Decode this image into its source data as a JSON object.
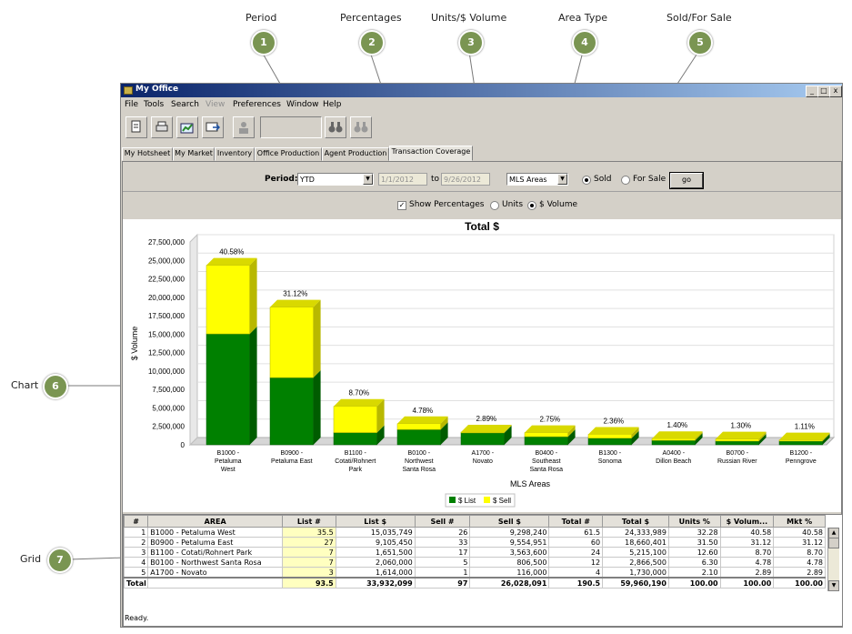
{
  "callouts": [
    {
      "num": "1",
      "label": "Period"
    },
    {
      "num": "2",
      "label": "Percentages"
    },
    {
      "num": "3",
      "label": "Units/$ Volume"
    },
    {
      "num": "4",
      "label": "Area Type"
    },
    {
      "num": "5",
      "label": "Sold/For Sale"
    },
    {
      "num": "6",
      "label": "Chart"
    },
    {
      "num": "7",
      "label": "Grid"
    }
  ],
  "window": {
    "title": "My Office",
    "controls": [
      "_",
      "□",
      "x"
    ]
  },
  "menu": [
    "File",
    "Tools",
    "Search",
    "View",
    "Preferences",
    "Window",
    "Help"
  ],
  "tabs": [
    "My Hotsheet",
    "My Market",
    "Inventory",
    "Office Production",
    "Agent Production",
    "Transaction Coverage"
  ],
  "active_tab": "Transaction Coverage",
  "filters": {
    "period_label": "Period:",
    "period_value": "YTD",
    "date_from": "1/1/2012",
    "to_label": "to",
    "date_to": "9/26/2012",
    "area_type": "MLS Areas",
    "sold_label": "Sold",
    "for_sale_label": "For Sale",
    "go_label": "go",
    "show_percentages": "Show Percentages",
    "units_label": "Units",
    "volume_label": "$ Volume"
  },
  "colors": {
    "list": "#008000",
    "sell": "#ffff00",
    "accent": "#7a9552"
  },
  "chart_data": {
    "type": "bar",
    "stacked": true,
    "title": "Total $",
    "xlabel": "MLS Areas",
    "ylabel": "$ Volume",
    "ylim": [
      0,
      27500000
    ],
    "yticks": [
      "27,500,000",
      "25,000,000",
      "22,500,000",
      "20,000,000",
      "17,500,000",
      "15,000,000",
      "12,500,000",
      "10,000,000",
      "7,500,000",
      "5,000,000",
      "2,500,000",
      "0"
    ],
    "categories": [
      [
        "B1000 -",
        "Petaluma",
        "West"
      ],
      [
        "B0900 -",
        "Petaluma East"
      ],
      [
        "B1100 -",
        "Cotati/Rohnert",
        "Park"
      ],
      [
        "B0100 -",
        "Northwest",
        "Santa Rosa"
      ],
      [
        "A1700 -",
        "Novato"
      ],
      [
        "B0400 -",
        "Southeast",
        "Santa Rosa"
      ],
      [
        "B1300 -",
        "Sonoma"
      ],
      [
        "A0400 -",
        "Dillon Beach"
      ],
      [
        "B0700 -",
        "Russian River"
      ],
      [
        "B1200 -",
        "Penngrove"
      ]
    ],
    "series": [
      {
        "name": "$ List",
        "values": [
          15035749,
          9105450,
          1651500,
          2060000,
          1614000,
          1100000,
          900000,
          600000,
          500000,
          500000
        ]
      },
      {
        "name": "$ Sell",
        "values": [
          9298240,
          9554951,
          3563600,
          806500,
          116000,
          550000,
          520000,
          240000,
          280000,
          170000
        ]
      }
    ],
    "bar_labels": [
      "40.58%",
      "31.12%",
      "8.70%",
      "4.78%",
      "2.89%",
      "2.75%",
      "2.36%",
      "1.40%",
      "1.30%",
      "1.11%"
    ],
    "legend": "bottom-center"
  },
  "grid": {
    "columns": [
      "#",
      "AREA",
      "List #",
      "List $",
      "Sell #",
      "Sell $",
      "Total #",
      "Total $",
      "Units %",
      "$ Volum...",
      "Mkt %"
    ],
    "rows": [
      [
        "1",
        "B1000 - Petaluma West",
        "35.5",
        "15,035,749",
        "26",
        "9,298,240",
        "61.5",
        "24,333,989",
        "32.28",
        "40.58",
        "40.58"
      ],
      [
        "2",
        "B0900 - Petaluma East",
        "27",
        "9,105,450",
        "33",
        "9,554,951",
        "60",
        "18,660,401",
        "31.50",
        "31.12",
        "31.12"
      ],
      [
        "3",
        "B1100 - Cotati/Rohnert Park",
        "7",
        "1,651,500",
        "17",
        "3,563,600",
        "24",
        "5,215,100",
        "12.60",
        "8.70",
        "8.70"
      ],
      [
        "4",
        "B0100 - Northwest Santa Rosa",
        "7",
        "2,060,000",
        "5",
        "806,500",
        "12",
        "2,866,500",
        "6.30",
        "4.78",
        "4.78"
      ],
      [
        "5",
        "A1700 - Novato",
        "3",
        "1,614,000",
        "1",
        "116,000",
        "4",
        "1,730,000",
        "2.10",
        "2.89",
        "2.89"
      ]
    ],
    "total": [
      "Total",
      "",
      "93.5",
      "33,932,099",
      "97",
      "26,028,091",
      "190.5",
      "59,960,190",
      "100.00",
      "100.00",
      "100.00"
    ]
  },
  "status": "Ready."
}
